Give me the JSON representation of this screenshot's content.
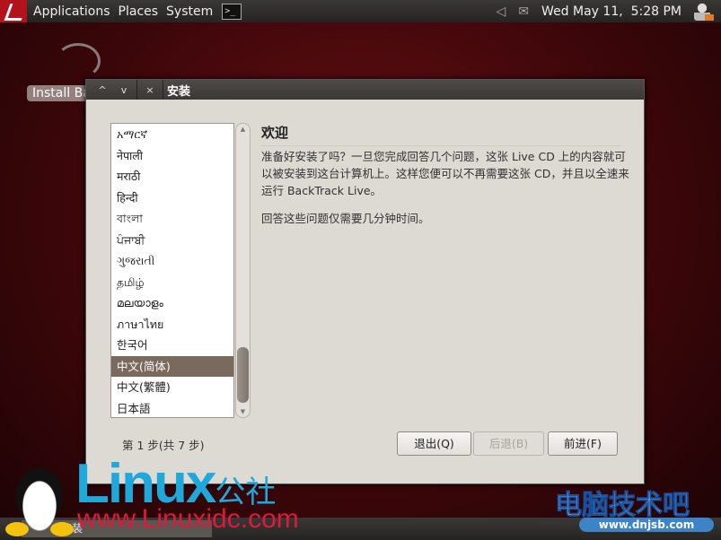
{
  "topbar": {
    "menus": [
      "Applications",
      "Places",
      "System"
    ],
    "terminal_glyph": ">_",
    "clock": "Wed May 11,  5:28 PM",
    "icons": [
      "backtrack-logo-icon",
      "terminal-icon",
      "volume-icon",
      "mail-icon",
      "user-icon"
    ]
  },
  "desktop": {
    "install_icon_label": "Install Ba"
  },
  "dialog": {
    "title": "安装",
    "title_buttons": [
      "^",
      "v",
      "×"
    ],
    "languages": [
      "አማርኛ",
      "नेपाली",
      "मराठी",
      "हिन्दी",
      "বাংলা",
      "ਪੰਜਾਬੀ",
      "ગુજરાતી",
      "தமிழ்",
      "മലയാളം",
      "ภาษาไทย",
      "한국어",
      "中文(简体)",
      "中文(繁體)",
      "日本語"
    ],
    "selected_language": "中文(简体)",
    "heading": "欢迎",
    "body1": "准备好安装了吗？一旦您完成回答几个问题，这张 Live CD 上的内容就可以被安装到这台计算机上。这样您便可以不再需要这张 CD，并且以全速来运行 BackTrack Live。",
    "body2": "回答这些问题仅需要几分钟时间。",
    "step": "第 1 步(共 7 步)",
    "buttons": {
      "quit": "退出(Q)",
      "back": "后退(B)",
      "forward": "前进(F)"
    }
  },
  "taskbar": {
    "task_label": "安装"
  },
  "watermarks": {
    "linux": "Linux",
    "linux_cn": "公社",
    "url": "www.Linuxidc.com",
    "cn2": "电脑技术吧",
    "url2": "www.dnjsb.com"
  },
  "colors": {
    "selection": "#7a6a5e",
    "dialog_bg": "#ddd9d3",
    "linux_blue": "#1fa8dc",
    "linux_red": "#e0193b"
  }
}
